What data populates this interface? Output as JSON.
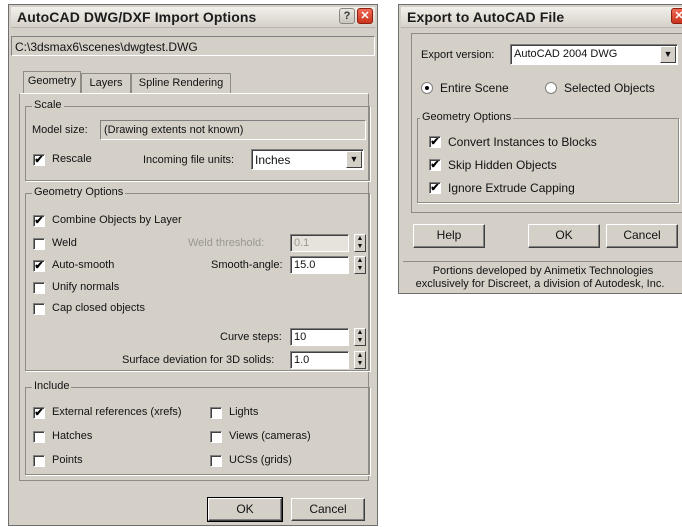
{
  "import": {
    "title": "AutoCAD DWG/DXF Import Options",
    "path": "C:\\3dsmax6\\scenes\\dwgtest.DWG",
    "tabs": [
      "Geometry",
      "Layers",
      "Spline Rendering"
    ],
    "scale": {
      "legend": "Scale",
      "model_size_label": "Model size:",
      "model_size_value": "(Drawing extents not known)",
      "rescale_label": "Rescale",
      "units_label": "Incoming file units:",
      "units_value": "Inches"
    },
    "geometry": {
      "legend": "Geometry Options",
      "combine": "Combine Objects by Layer",
      "weld": "Weld",
      "weld_threshold_label": "Weld threshold:",
      "weld_threshold_value": "0.1",
      "autosmooth": "Auto-smooth",
      "smooth_angle_label": "Smooth-angle:",
      "smooth_angle_value": "15.0",
      "unify": "Unify normals",
      "cap": "Cap closed objects",
      "curve_steps_label": "Curve steps:",
      "curve_steps_value": "10",
      "surface_dev_label": "Surface deviation for 3D solids:",
      "surface_dev_value": "1.0"
    },
    "include": {
      "legend": "Include",
      "xrefs": "External references (xrefs)",
      "hatches": "Hatches",
      "points": "Points",
      "lights": "Lights",
      "views": "Views (cameras)",
      "ucss": "UCSs (grids)"
    },
    "ok": "OK",
    "cancel": "Cancel"
  },
  "export": {
    "title": "Export to AutoCAD File",
    "version_label": "Export version:",
    "version_value": "AutoCAD 2004 DWG",
    "entire_scene": "Entire Scene",
    "selected_objects": "Selected Objects",
    "geometry_legend": "Geometry Options",
    "convert_instances": "Convert Instances to Blocks",
    "skip_hidden": "Skip Hidden Objects",
    "ignore_extrude": "Ignore Extrude Capping",
    "help": "Help",
    "ok": "OK",
    "cancel": "Cancel",
    "footer_line1": "Portions developed by Animetix Technologies",
    "footer_line2": "exclusively for Discreet, a division of Autodesk, Inc."
  },
  "glyphs": {
    "check": "✔",
    "help": "?",
    "close": "✕",
    "arrow_down": "▼",
    "arrow_up": "▲"
  }
}
